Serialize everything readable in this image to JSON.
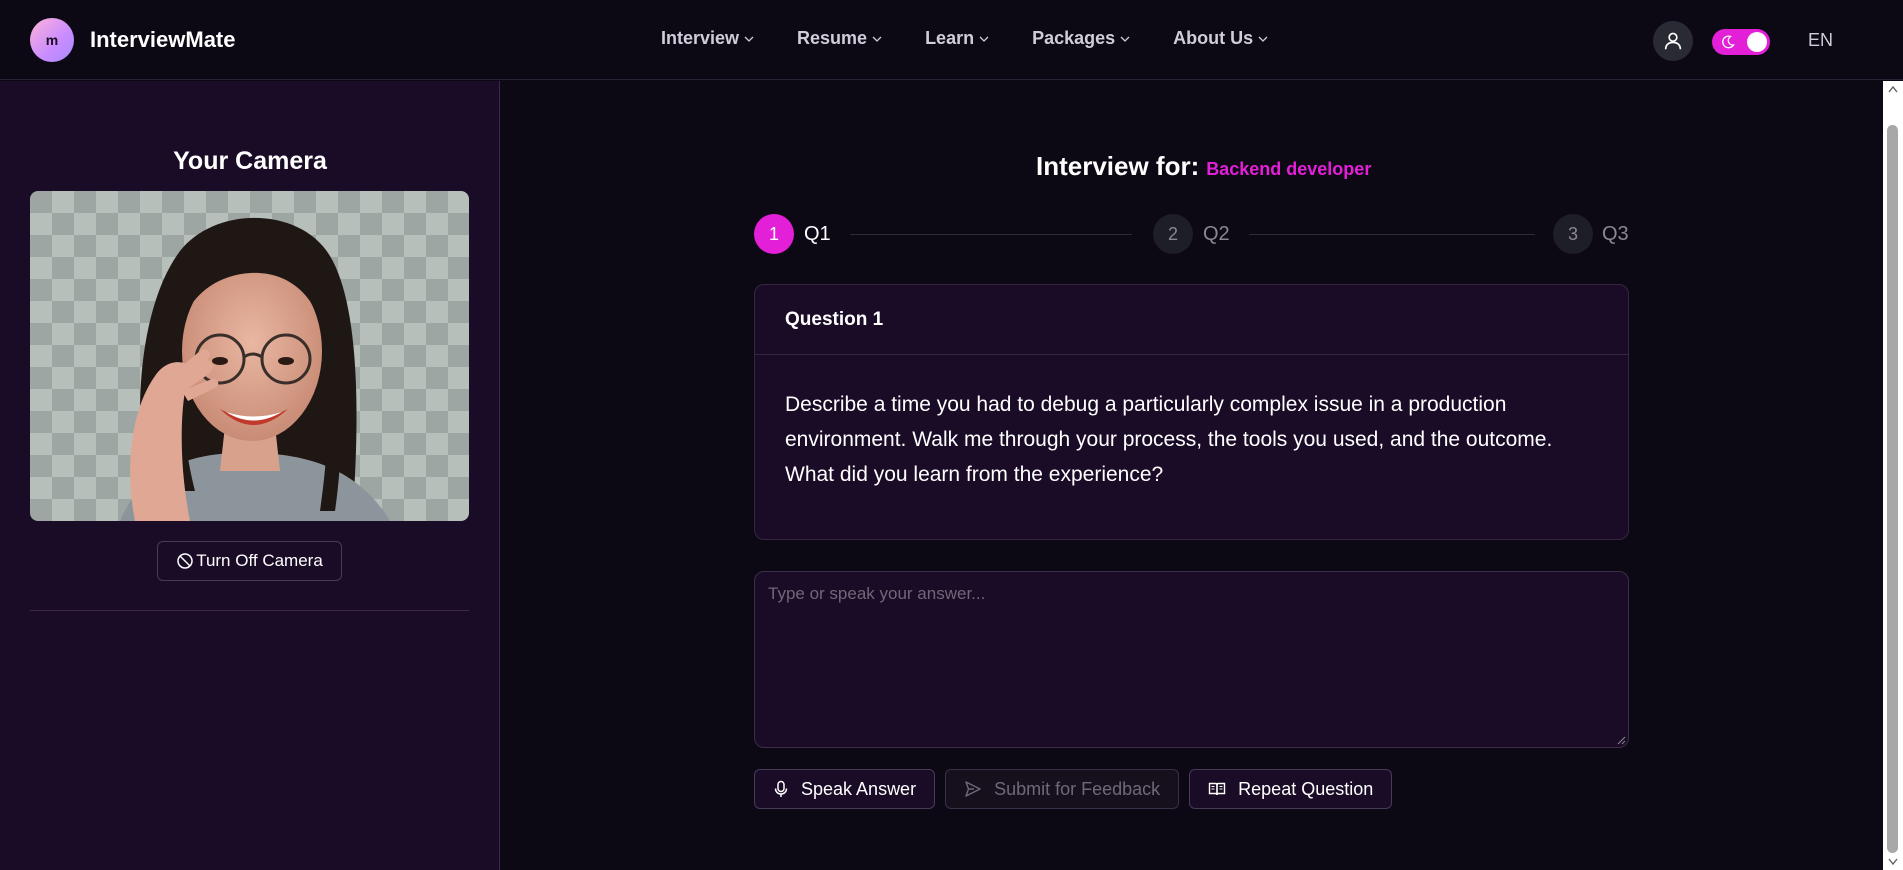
{
  "header": {
    "logo_letter": "m",
    "brand": "InterviewMate",
    "nav": [
      {
        "label": "Interview"
      },
      {
        "label": "Resume"
      },
      {
        "label": "Learn"
      },
      {
        "label": "Packages"
      },
      {
        "label": "About Us"
      }
    ],
    "language": "EN",
    "theme_toggle": {
      "state": "dark",
      "accent": "#e31fd8"
    }
  },
  "sidebar": {
    "camera_title": "Your Camera",
    "camera_toggle_label": "Turn Off Camera"
  },
  "interview": {
    "label": "Interview for:",
    "role": "Backend developer",
    "steps": [
      {
        "number": "1",
        "label": "Q1",
        "state": "active"
      },
      {
        "number": "2",
        "label": "Q2",
        "state": "idle"
      },
      {
        "number": "3",
        "label": "Q3",
        "state": "idle"
      }
    ],
    "question_title": "Question 1",
    "question_text": "Describe a time you had to debug a particularly complex issue in a production environment. Walk me through your process, the tools you used, and the outcome. What did you learn from the experience?",
    "answer_placeholder": "Type or speak your answer...",
    "answer_value": "",
    "buttons": {
      "speak": "Speak Answer",
      "submit": "Submit for Feedback",
      "repeat": "Repeat Question"
    }
  },
  "colors": {
    "accent": "#e31fd8",
    "background": "#0c0814",
    "panel": "#1a0b26"
  }
}
